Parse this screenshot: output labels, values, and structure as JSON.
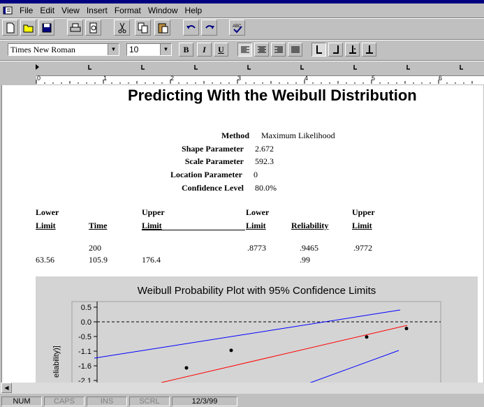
{
  "menu": [
    "File",
    "Edit",
    "View",
    "Insert",
    "Format",
    "Window",
    "Help"
  ],
  "format": {
    "font": "Times New Roman",
    "size": "10",
    "bold": "B",
    "italic": "I",
    "underline": "U"
  },
  "ruler_numbers": [
    "0",
    "1",
    "2",
    "3",
    "4",
    "5",
    "6"
  ],
  "document": {
    "title": "Predicting With the Weibull Distribution",
    "params": [
      {
        "label": "Method",
        "value": "Maximum Likelihood"
      },
      {
        "label": "Shape Parameter",
        "value": "2.672"
      },
      {
        "label": "Scale Parameter",
        "value": "592.3"
      },
      {
        "label": "Location Parameter",
        "value": "0"
      },
      {
        "label": "Confidence Level",
        "value": "80.0%"
      }
    ],
    "table": {
      "top_headers": [
        "Lower",
        "Upper",
        "Lower",
        "Upper"
      ],
      "bottom_headers": [
        "Limit",
        "Time",
        "Limit",
        "Limit",
        "Reliability",
        "Limit"
      ],
      "rows": [
        [
          "",
          "200",
          "",
          ".8773",
          ".9465",
          ".9772"
        ],
        [
          "63.56",
          "105.9",
          "176.4",
          "",
          ".99",
          ""
        ]
      ]
    }
  },
  "chart_data": {
    "type": "scatter",
    "title": "Weibull Probability Plot with 95% Confidence Limits",
    "ylabel": "eliability)]",
    "y_ticks": [
      "0.5",
      "0.0",
      "-0.5",
      "-1.1",
      "-1.6",
      "-2.1"
    ],
    "y_tick_values": [
      0.5,
      0.0,
      -0.55,
      -1.1,
      -1.6,
      -2.1
    ],
    "reference_line_y": 0.0,
    "points": [
      {
        "y": -1.67
      },
      {
        "y": -1.07
      },
      {
        "y": -0.57
      },
      {
        "y": -0.25
      }
    ],
    "series": [
      {
        "color": "#0000ff"
      },
      {
        "color": "#ff0000"
      },
      {
        "color": "#0000ff"
      }
    ]
  },
  "status": {
    "num": "NUM",
    "caps": "CAPS",
    "ins": "INS",
    "scrl": "SCRL",
    "date": "12/3/99"
  }
}
